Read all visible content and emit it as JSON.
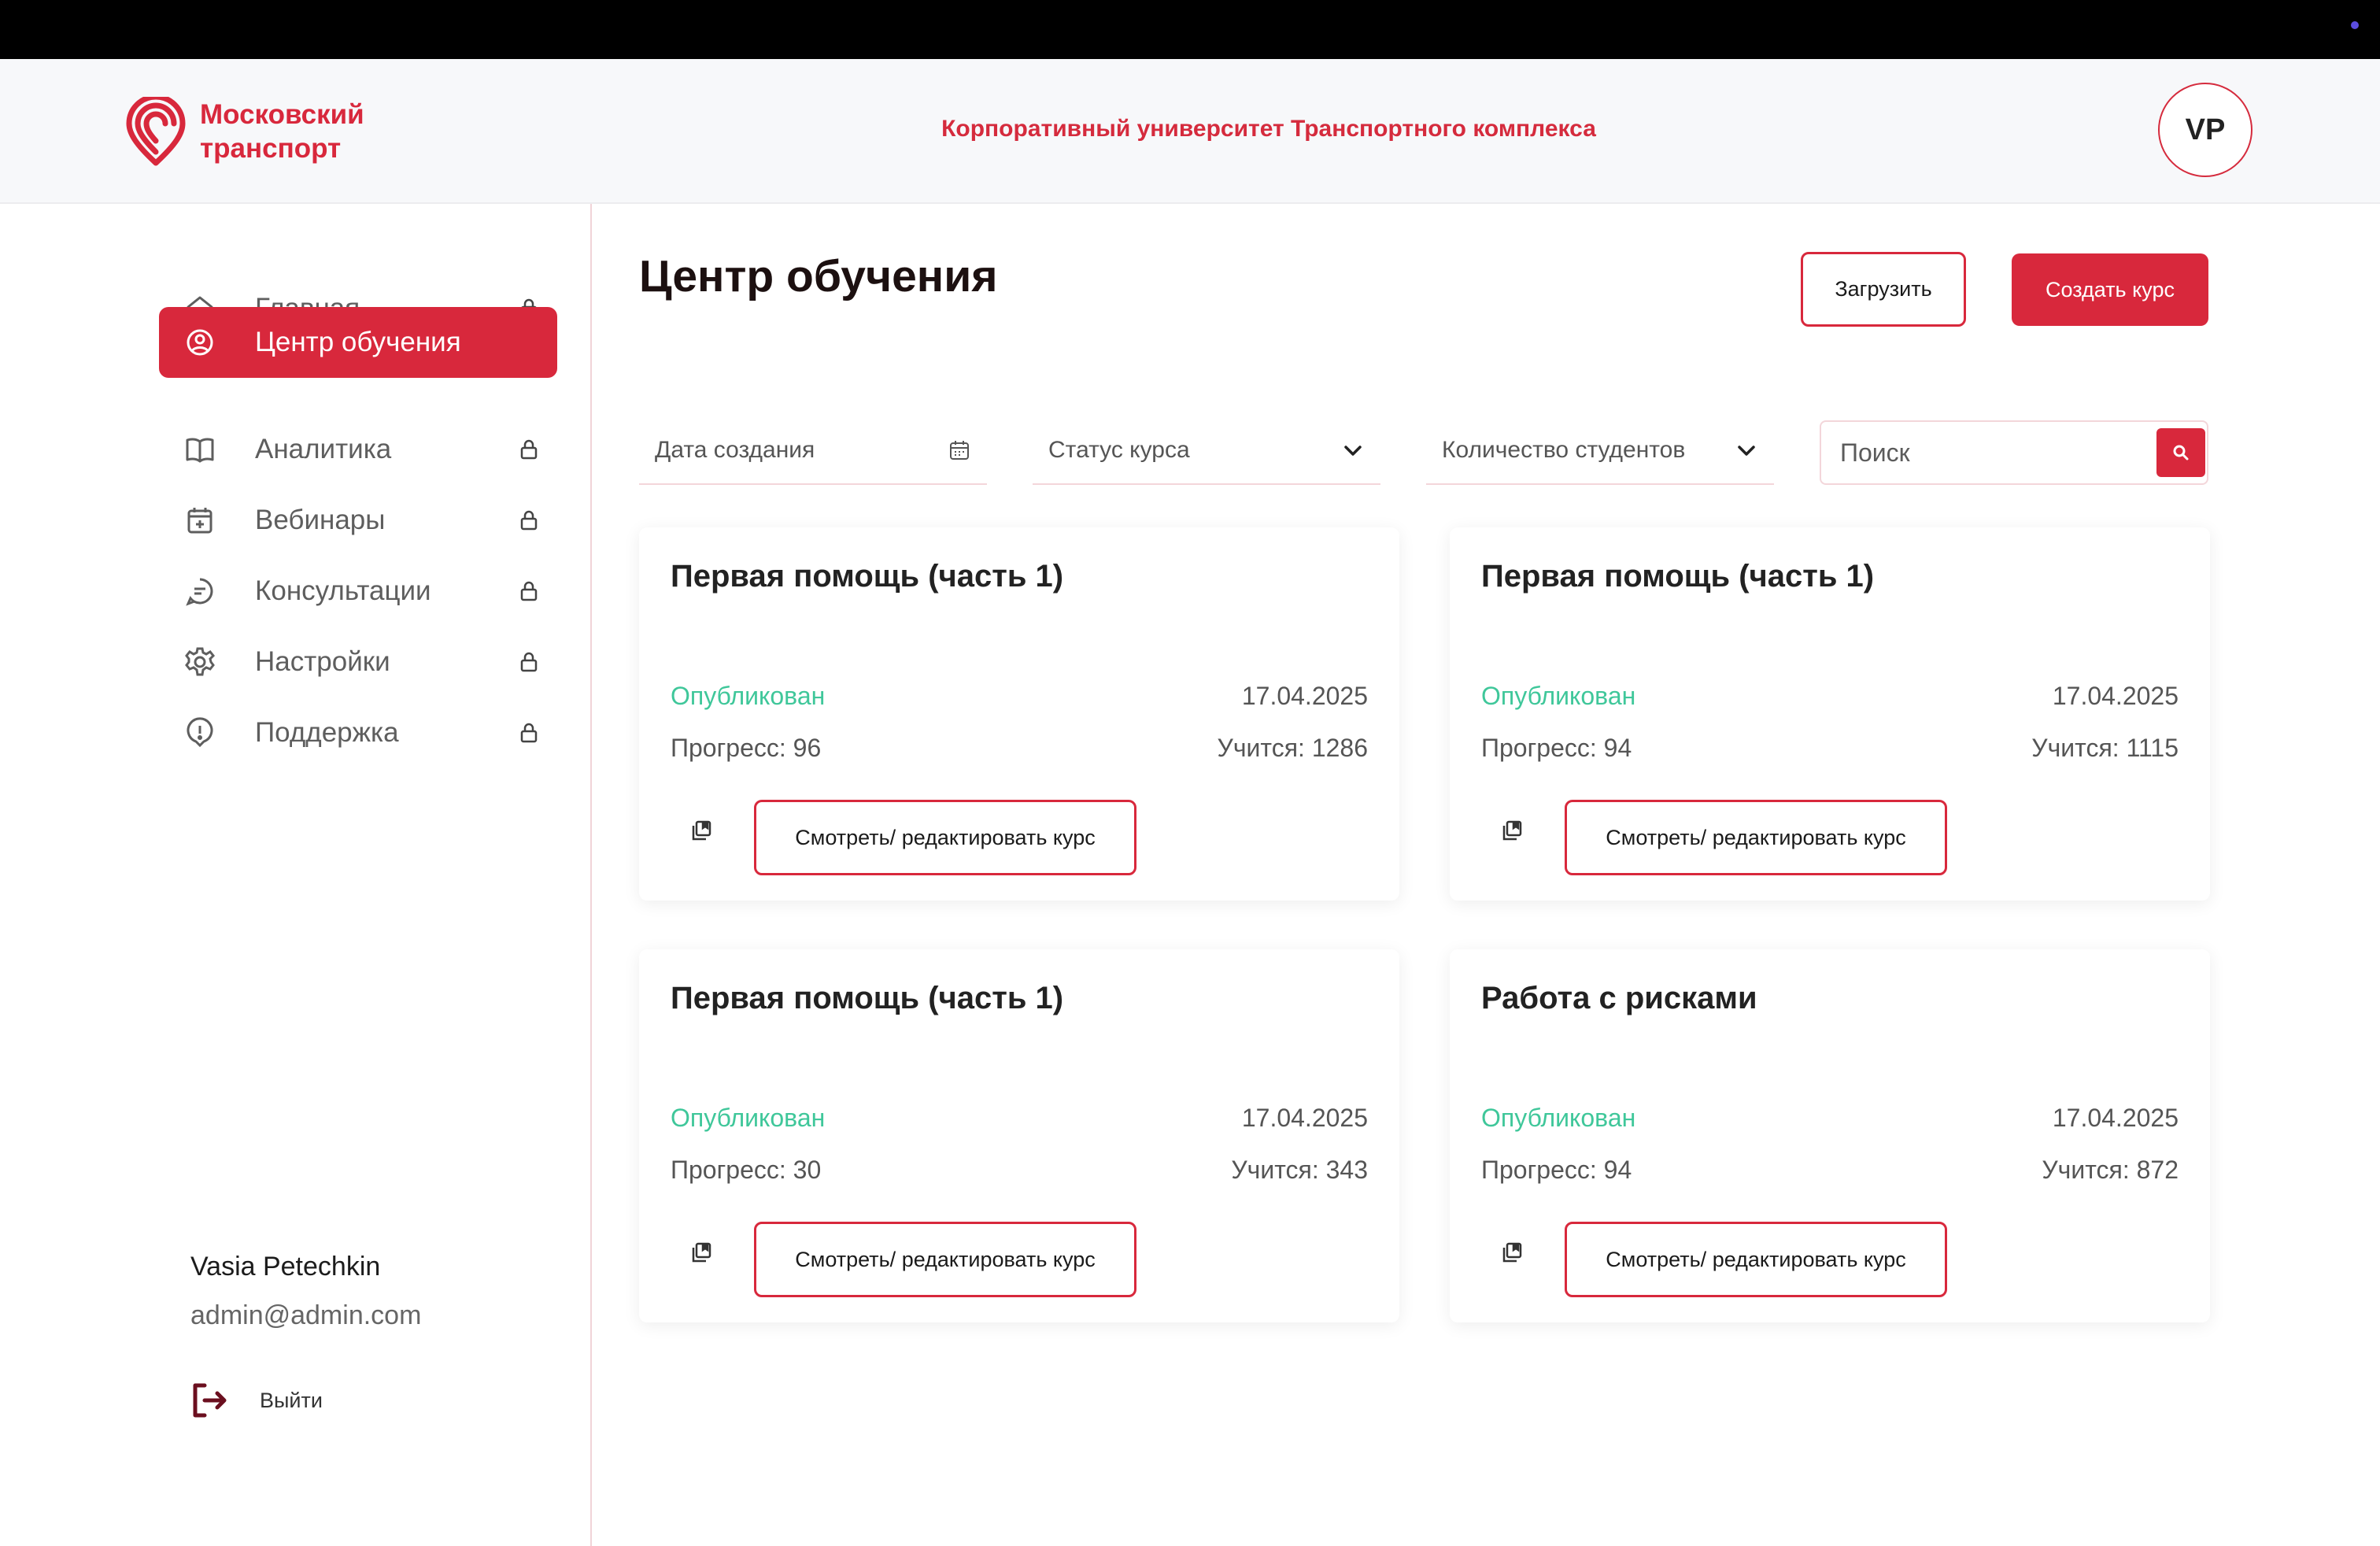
{
  "brand": {
    "logo_text": "Московский\nтранспорт",
    "header_title": "Корпоративный университет Транспортного комплекса",
    "accent": "#d8283c",
    "status_color": "#3fc79a"
  },
  "user": {
    "initials": "VP",
    "name": "Vasia Petechkin",
    "email": "admin@admin.com",
    "logout_label": "Выйти"
  },
  "sidebar": {
    "items": [
      {
        "label": "Главная",
        "icon": "home-icon",
        "locked": true,
        "active": false
      },
      {
        "label": "Центр обучения",
        "icon": "user-circle-icon",
        "locked": false,
        "active": true
      },
      {
        "label": "Аналитика",
        "icon": "book-open-icon",
        "locked": true,
        "active": false
      },
      {
        "label": "Вебинары",
        "icon": "calendar-plus-icon",
        "locked": true,
        "active": false
      },
      {
        "label": "Консультации",
        "icon": "chat-bubble-icon",
        "locked": true,
        "active": false
      },
      {
        "label": "Настройки",
        "icon": "gear-icon",
        "locked": true,
        "active": false
      },
      {
        "label": "Поддержка",
        "icon": "support-icon",
        "locked": true,
        "active": false
      }
    ]
  },
  "main": {
    "title": "Центр обучения",
    "upload_label": "Загрузить",
    "create_label": "Создать курс",
    "filters": {
      "date_label": "Дата создания",
      "status_label": "Статус курса",
      "students_label": "Количество студентов",
      "search_placeholder": "Поиск"
    },
    "courses": [
      {
        "title": "Первая помощь (часть 1)",
        "status": "Опубликован",
        "date": "17.04.2025",
        "progress": "Прогресс: 96",
        "students": "Учится: 1286",
        "action": "Смотреть/ редактировать курс"
      },
      {
        "title": "Первая помощь (часть 1)",
        "status": "Опубликован",
        "date": "17.04.2025",
        "progress": "Прогресс: 94",
        "students": "Учится: 1115",
        "action": "Смотреть/ редактировать курс"
      },
      {
        "title": "Первая помощь (часть 1)",
        "status": "Опубликован",
        "date": "17.04.2025",
        "progress": "Прогресс: 30",
        "students": "Учится: 343",
        "action": "Смотреть/ редактировать курс"
      },
      {
        "title": "Работа с рисками",
        "status": "Опубликован",
        "date": "17.04.2025",
        "progress": "Прогресс: 94",
        "students": "Учится: 872",
        "action": "Смотреть/ редактировать курс"
      }
    ]
  }
}
